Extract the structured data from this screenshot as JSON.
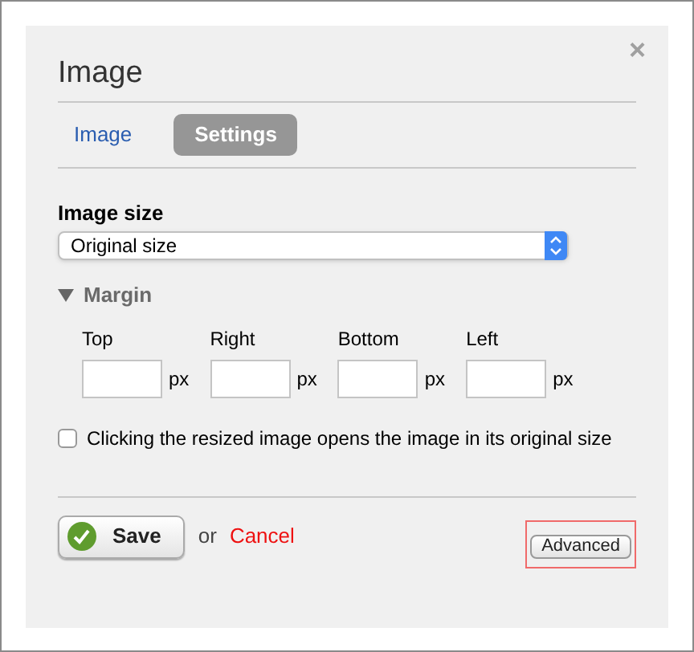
{
  "dialog": {
    "title": "Image",
    "close": "×"
  },
  "tabs": [
    {
      "label": "Image",
      "selected": false
    },
    {
      "label": "Settings",
      "selected": true
    }
  ],
  "image_size": {
    "label": "Image size",
    "value": "Original size"
  },
  "margin": {
    "title": "Margin",
    "expanded": true,
    "fields": [
      {
        "label": "Top",
        "unit": "px"
      },
      {
        "label": "Right",
        "unit": "px"
      },
      {
        "label": "Bottom",
        "unit": "px"
      },
      {
        "label": "Left",
        "unit": "px"
      }
    ]
  },
  "open_original": {
    "label": "Clicking the resized image opens the image in its original size",
    "checked": false
  },
  "footer": {
    "save": "Save",
    "or": "or",
    "cancel": "Cancel",
    "advanced": "Advanced",
    "advanced_highlighted": true
  }
}
